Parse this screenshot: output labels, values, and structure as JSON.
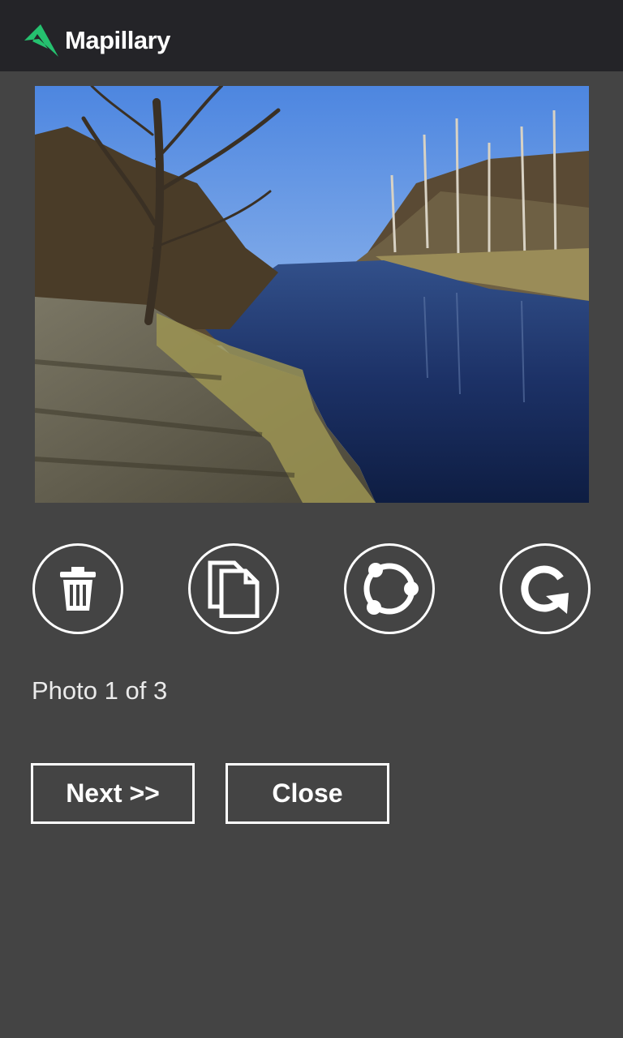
{
  "app": {
    "brand_name": "Mapillary",
    "brand_color": "#25c16f",
    "background_color": "#444444",
    "header_color": "#242428"
  },
  "photo": {
    "description": "Riverside path with birch trees and blue sky"
  },
  "actions": [
    {
      "name": "delete",
      "icon": "trash-icon"
    },
    {
      "name": "copy",
      "icon": "copy-icon"
    },
    {
      "name": "sync",
      "icon": "sync-icon"
    },
    {
      "name": "rotate",
      "icon": "rotate-icon"
    }
  ],
  "status": {
    "text": "Photo 1 of 3"
  },
  "buttons": {
    "next_label": "Next >>",
    "close_label": "Close"
  }
}
